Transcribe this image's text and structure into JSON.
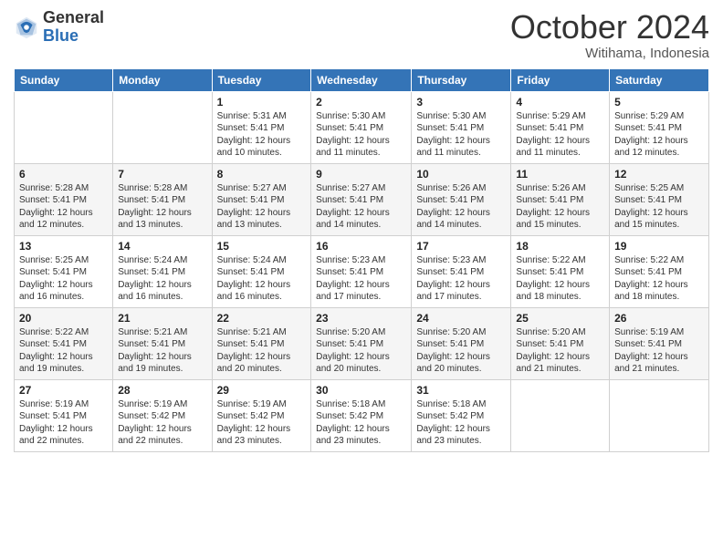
{
  "header": {
    "logo_general": "General",
    "logo_blue": "Blue",
    "month_title": "October 2024",
    "location": "Witihama, Indonesia"
  },
  "weekdays": [
    "Sunday",
    "Monday",
    "Tuesday",
    "Wednesday",
    "Thursday",
    "Friday",
    "Saturday"
  ],
  "weeks": [
    [
      {
        "day": "",
        "sunrise": "",
        "sunset": "",
        "daylight": ""
      },
      {
        "day": "",
        "sunrise": "",
        "sunset": "",
        "daylight": ""
      },
      {
        "day": "1",
        "sunrise": "Sunrise: 5:31 AM",
        "sunset": "Sunset: 5:41 PM",
        "daylight": "Daylight: 12 hours and 10 minutes."
      },
      {
        "day": "2",
        "sunrise": "Sunrise: 5:30 AM",
        "sunset": "Sunset: 5:41 PM",
        "daylight": "Daylight: 12 hours and 11 minutes."
      },
      {
        "day": "3",
        "sunrise": "Sunrise: 5:30 AM",
        "sunset": "Sunset: 5:41 PM",
        "daylight": "Daylight: 12 hours and 11 minutes."
      },
      {
        "day": "4",
        "sunrise": "Sunrise: 5:29 AM",
        "sunset": "Sunset: 5:41 PM",
        "daylight": "Daylight: 12 hours and 11 minutes."
      },
      {
        "day": "5",
        "sunrise": "Sunrise: 5:29 AM",
        "sunset": "Sunset: 5:41 PM",
        "daylight": "Daylight: 12 hours and 12 minutes."
      }
    ],
    [
      {
        "day": "6",
        "sunrise": "Sunrise: 5:28 AM",
        "sunset": "Sunset: 5:41 PM",
        "daylight": "Daylight: 12 hours and 12 minutes."
      },
      {
        "day": "7",
        "sunrise": "Sunrise: 5:28 AM",
        "sunset": "Sunset: 5:41 PM",
        "daylight": "Daylight: 12 hours and 13 minutes."
      },
      {
        "day": "8",
        "sunrise": "Sunrise: 5:27 AM",
        "sunset": "Sunset: 5:41 PM",
        "daylight": "Daylight: 12 hours and 13 minutes."
      },
      {
        "day": "9",
        "sunrise": "Sunrise: 5:27 AM",
        "sunset": "Sunset: 5:41 PM",
        "daylight": "Daylight: 12 hours and 14 minutes."
      },
      {
        "day": "10",
        "sunrise": "Sunrise: 5:26 AM",
        "sunset": "Sunset: 5:41 PM",
        "daylight": "Daylight: 12 hours and 14 minutes."
      },
      {
        "day": "11",
        "sunrise": "Sunrise: 5:26 AM",
        "sunset": "Sunset: 5:41 PM",
        "daylight": "Daylight: 12 hours and 15 minutes."
      },
      {
        "day": "12",
        "sunrise": "Sunrise: 5:25 AM",
        "sunset": "Sunset: 5:41 PM",
        "daylight": "Daylight: 12 hours and 15 minutes."
      }
    ],
    [
      {
        "day": "13",
        "sunrise": "Sunrise: 5:25 AM",
        "sunset": "Sunset: 5:41 PM",
        "daylight": "Daylight: 12 hours and 16 minutes."
      },
      {
        "day": "14",
        "sunrise": "Sunrise: 5:24 AM",
        "sunset": "Sunset: 5:41 PM",
        "daylight": "Daylight: 12 hours and 16 minutes."
      },
      {
        "day": "15",
        "sunrise": "Sunrise: 5:24 AM",
        "sunset": "Sunset: 5:41 PM",
        "daylight": "Daylight: 12 hours and 16 minutes."
      },
      {
        "day": "16",
        "sunrise": "Sunrise: 5:23 AM",
        "sunset": "Sunset: 5:41 PM",
        "daylight": "Daylight: 12 hours and 17 minutes."
      },
      {
        "day": "17",
        "sunrise": "Sunrise: 5:23 AM",
        "sunset": "Sunset: 5:41 PM",
        "daylight": "Daylight: 12 hours and 17 minutes."
      },
      {
        "day": "18",
        "sunrise": "Sunrise: 5:22 AM",
        "sunset": "Sunset: 5:41 PM",
        "daylight": "Daylight: 12 hours and 18 minutes."
      },
      {
        "day": "19",
        "sunrise": "Sunrise: 5:22 AM",
        "sunset": "Sunset: 5:41 PM",
        "daylight": "Daylight: 12 hours and 18 minutes."
      }
    ],
    [
      {
        "day": "20",
        "sunrise": "Sunrise: 5:22 AM",
        "sunset": "Sunset: 5:41 PM",
        "daylight": "Daylight: 12 hours and 19 minutes."
      },
      {
        "day": "21",
        "sunrise": "Sunrise: 5:21 AM",
        "sunset": "Sunset: 5:41 PM",
        "daylight": "Daylight: 12 hours and 19 minutes."
      },
      {
        "day": "22",
        "sunrise": "Sunrise: 5:21 AM",
        "sunset": "Sunset: 5:41 PM",
        "daylight": "Daylight: 12 hours and 20 minutes."
      },
      {
        "day": "23",
        "sunrise": "Sunrise: 5:20 AM",
        "sunset": "Sunset: 5:41 PM",
        "daylight": "Daylight: 12 hours and 20 minutes."
      },
      {
        "day": "24",
        "sunrise": "Sunrise: 5:20 AM",
        "sunset": "Sunset: 5:41 PM",
        "daylight": "Daylight: 12 hours and 20 minutes."
      },
      {
        "day": "25",
        "sunrise": "Sunrise: 5:20 AM",
        "sunset": "Sunset: 5:41 PM",
        "daylight": "Daylight: 12 hours and 21 minutes."
      },
      {
        "day": "26",
        "sunrise": "Sunrise: 5:19 AM",
        "sunset": "Sunset: 5:41 PM",
        "daylight": "Daylight: 12 hours and 21 minutes."
      }
    ],
    [
      {
        "day": "27",
        "sunrise": "Sunrise: 5:19 AM",
        "sunset": "Sunset: 5:41 PM",
        "daylight": "Daylight: 12 hours and 22 minutes."
      },
      {
        "day": "28",
        "sunrise": "Sunrise: 5:19 AM",
        "sunset": "Sunset: 5:42 PM",
        "daylight": "Daylight: 12 hours and 22 minutes."
      },
      {
        "day": "29",
        "sunrise": "Sunrise: 5:19 AM",
        "sunset": "Sunset: 5:42 PM",
        "daylight": "Daylight: 12 hours and 23 minutes."
      },
      {
        "day": "30",
        "sunrise": "Sunrise: 5:18 AM",
        "sunset": "Sunset: 5:42 PM",
        "daylight": "Daylight: 12 hours and 23 minutes."
      },
      {
        "day": "31",
        "sunrise": "Sunrise: 5:18 AM",
        "sunset": "Sunset: 5:42 PM",
        "daylight": "Daylight: 12 hours and 23 minutes."
      },
      {
        "day": "",
        "sunrise": "",
        "sunset": "",
        "daylight": ""
      },
      {
        "day": "",
        "sunrise": "",
        "sunset": "",
        "daylight": ""
      }
    ]
  ]
}
